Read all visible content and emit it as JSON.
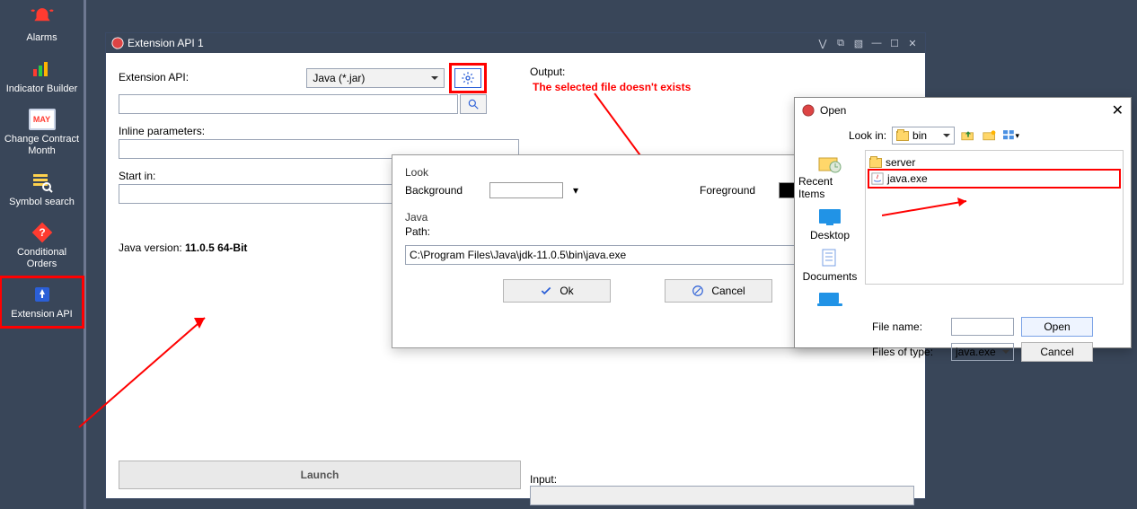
{
  "sidebar": [
    {
      "label": "Alarms"
    },
    {
      "label": "Indicator Builder"
    },
    {
      "label": "Change Contract Month",
      "badge": "MAY"
    },
    {
      "label": "Symbol search"
    },
    {
      "label": "Conditional Orders"
    },
    {
      "label": "Extension API"
    }
  ],
  "mainwin": {
    "title": "Extension API 1",
    "labels": {
      "ext_api": "Extension API:",
      "inline": "Inline parameters:",
      "startin": "Start in:",
      "output": "Output:",
      "input": "Input:",
      "javaver_prefix": "Java version: ",
      "javaver_value": "11.0.5 64-Bit"
    },
    "combo_value": "Java (*.jar)",
    "output_msg": "The selected file doesn't exists",
    "launch": "Launch"
  },
  "settings": {
    "look_hdr": "Look",
    "bg_label": "Background",
    "fg_label": "Foreground",
    "java_hdr": "Java",
    "path_label": "Path:",
    "path_value": "C:\\Program Files\\Java\\jdk-11.0.5\\bin\\java.exe",
    "ok": "Ok",
    "cancel": "Cancel"
  },
  "opendlg": {
    "title": "Open",
    "lookin_label": "Look in:",
    "dir": "bin",
    "places": [
      "Recent Items",
      "Desktop",
      "Documents"
    ],
    "files": [
      {
        "name": "server",
        "type": "folder"
      },
      {
        "name": "java.exe",
        "type": "file",
        "selected": true
      }
    ],
    "filename_label": "File name:",
    "filestype_label": "Files of type:",
    "filestype_value": "java.exe",
    "open_btn": "Open",
    "cancel_btn": "Cancel"
  }
}
